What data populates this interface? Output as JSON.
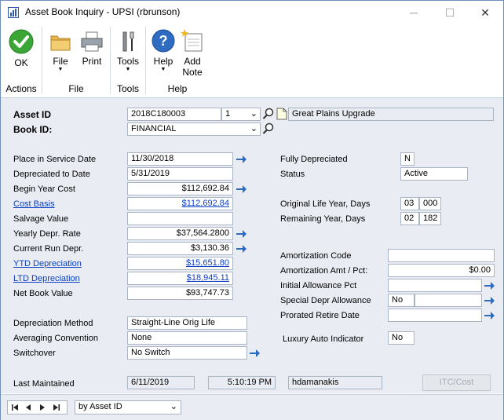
{
  "window": {
    "title": "Asset Book Inquiry  -  UPSI (rbrunson)",
    "minimize": "─",
    "maximize": "☐",
    "close": "✕"
  },
  "ribbon": {
    "ok": "OK",
    "file": "File",
    "print": "Print",
    "tools": "Tools",
    "help": "Help",
    "add_note_1": "Add",
    "add_note_2": "Note",
    "groups": {
      "actions": "Actions",
      "file": "File",
      "tools": "Tools",
      "help": "Help"
    }
  },
  "header": {
    "asset_id_label": "Asset ID",
    "asset_id_value": "2018C180003",
    "suffix_value": "1",
    "description": "Great Plains Upgrade",
    "book_id_label": "Book ID:",
    "book_id_value": "FINANCIAL"
  },
  "left": {
    "place_in_service_label": "Place in Service Date",
    "place_in_service_value": "11/30/2018",
    "depreciated_to_label": "Depreciated to Date",
    "depreciated_to_value": "5/31/2019",
    "begin_year_cost_label": "Begin Year Cost",
    "begin_year_cost_value": "$112,692.84",
    "cost_basis_label": "Cost Basis",
    "cost_basis_value": "$112,692.84",
    "salvage_label": "Salvage Value",
    "salvage_value": "",
    "yearly_rate_label": "Yearly Depr. Rate",
    "yearly_rate_value": "$37,564.2800",
    "current_run_label": "Current Run Depr.",
    "current_run_value": "$3,130.36",
    "ytd_label": "YTD Depreciation",
    "ytd_value": "$15,651.80",
    "ltd_label": "LTD Depreciation",
    "ltd_value": "$18,945.11",
    "nbv_label": "Net Book Value",
    "nbv_value": "$93,747.73",
    "method_label": "Depreciation Method",
    "method_value": "Straight-Line Orig Life",
    "convention_label": "Averaging Convention",
    "convention_value": "None",
    "switchover_label": "Switchover",
    "switchover_value": "No Switch",
    "last_maintained_label": "Last Maintained",
    "last_date": "6/11/2019",
    "last_time": "5:10:19 PM",
    "last_user": "hdamanakis"
  },
  "right": {
    "fully_depr_label": "Fully Depreciated",
    "fully_depr_value": "N",
    "status_label": "Status",
    "status_value": "Active",
    "orig_life_label": "Original Life Year, Days",
    "orig_life_years": "03",
    "orig_life_days": "000",
    "remaining_label": "Remaining Year, Days",
    "remaining_years": "02",
    "remaining_days": "182",
    "amort_code_label": "Amortization Code",
    "amort_code_value": "",
    "amort_amt_label": "Amortization Amt / Pct:",
    "amort_amt_value": "$0.00",
    "initial_allow_label": "Initial Allowance Pct",
    "special_depr_label": "Special Depr Allowance",
    "special_depr_value": "No",
    "prorated_label": "Prorated Retire Date",
    "luxury_label": "Luxury Auto Indicator",
    "luxury_value": "No",
    "itc_button": "ITC/Cost"
  },
  "statusbar": {
    "sort_value": "by Asset ID"
  }
}
